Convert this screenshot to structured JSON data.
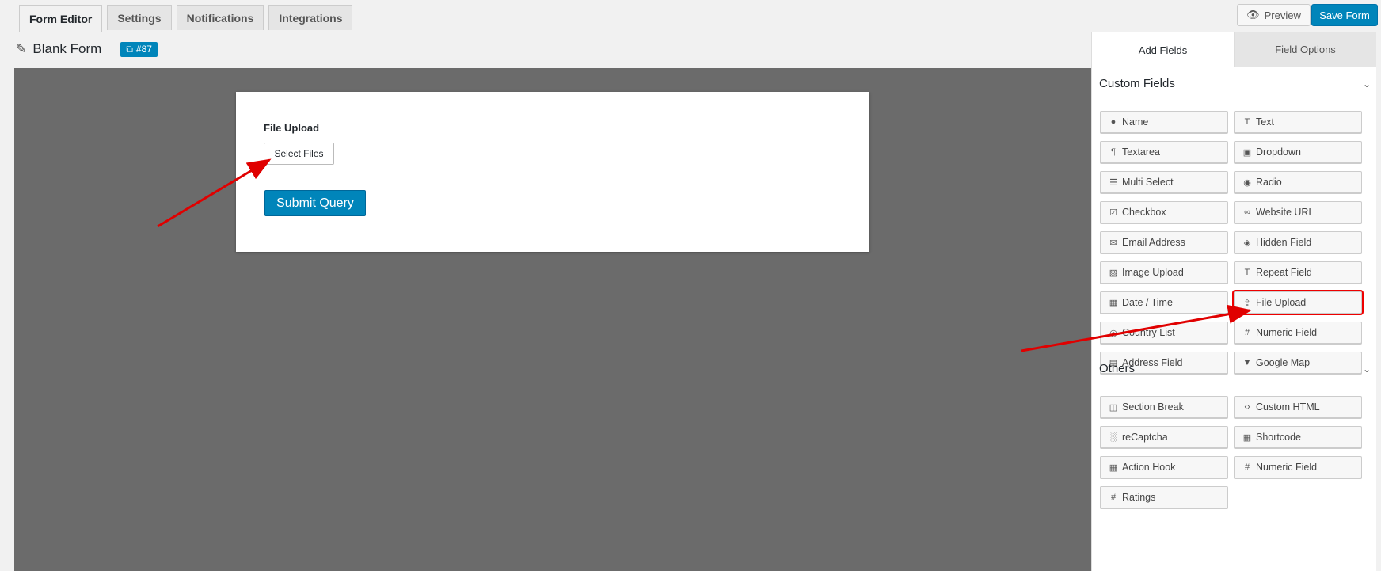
{
  "tabs": [
    "Form Editor",
    "Settings",
    "Notifications",
    "Integrations"
  ],
  "header": {
    "preview_label": "Preview",
    "save_label": "Save Form"
  },
  "form": {
    "title": "Blank Form",
    "id_badge": "#87"
  },
  "canvas": {
    "field_label": "File Upload",
    "select_files_label": "Select Files",
    "submit_label": "Submit Query"
  },
  "sidebar": {
    "tabs": [
      "Add Fields",
      "Field Options"
    ],
    "custom_heading": "Custom Fields",
    "others_heading": "Others",
    "custom_fields": [
      {
        "label": "Name",
        "icon": "●"
      },
      {
        "label": "Text",
        "icon": "T"
      },
      {
        "label": "Textarea",
        "icon": "¶"
      },
      {
        "label": "Dropdown",
        "icon": "▣"
      },
      {
        "label": "Multi Select",
        "icon": "☰"
      },
      {
        "label": "Radio",
        "icon": "◉"
      },
      {
        "label": "Checkbox",
        "icon": "☑"
      },
      {
        "label": "Website URL",
        "icon": "∞"
      },
      {
        "label": "Email Address",
        "icon": "✉"
      },
      {
        "label": "Hidden Field",
        "icon": "◈"
      },
      {
        "label": "Image Upload",
        "icon": "▨"
      },
      {
        "label": "Repeat Field",
        "icon": "T"
      },
      {
        "label": "Date / Time",
        "icon": "▦"
      },
      {
        "label": "File Upload",
        "icon": "⇪"
      },
      {
        "label": "Country List",
        "icon": "◎"
      },
      {
        "label": "Numeric Field",
        "icon": "#"
      },
      {
        "label": "Address Field",
        "icon": "▤"
      },
      {
        "label": "Google Map",
        "icon": "▼"
      }
    ],
    "other_fields": [
      {
        "label": "Section Break",
        "icon": "◫"
      },
      {
        "label": "Custom HTML",
        "icon": "‹›"
      },
      {
        "label": "reCaptcha",
        "icon": "░"
      },
      {
        "label": "Shortcode",
        "icon": "▦"
      },
      {
        "label": "Action Hook",
        "icon": "▦"
      },
      {
        "label": "Numeric Field",
        "icon": "#"
      },
      {
        "label": "Ratings",
        "icon": "#"
      }
    ],
    "highlighted_field": "File Upload"
  },
  "colors": {
    "primary": "#0085ba",
    "canvas": "#6b6b6b",
    "highlight": "#e00000"
  }
}
